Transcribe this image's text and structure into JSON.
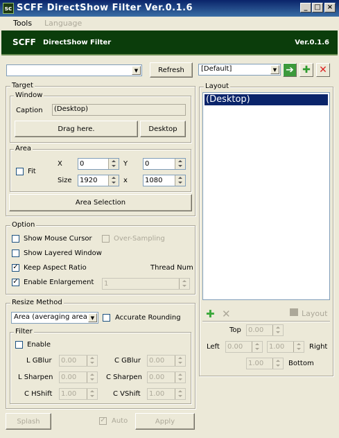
{
  "window": {
    "title": "SCFF DirectShow Filter Ver.0.1.6",
    "icon_text": "sc",
    "minimize": "_",
    "maximize": "□",
    "close": "×"
  },
  "menu": {
    "tools": "Tools",
    "language": "Language"
  },
  "banner": {
    "brand": "SCFF",
    "subtitle": "DirectShow Filter",
    "version": "Ver.0.1.6"
  },
  "top": {
    "process_combo": "",
    "refresh": "Refresh",
    "profile_combo": "[Default]"
  },
  "target": {
    "group": "Target",
    "window_group": "Window",
    "caption_label": "Caption",
    "caption_value": "(Desktop)",
    "drag_here": "Drag here.",
    "desktop": "Desktop",
    "area_group": "Area",
    "fit": "Fit",
    "x_label": "X",
    "y_label": "Y",
    "size_label": "Size",
    "x_sep": "x",
    "x_value": "0",
    "y_value": "0",
    "width": "1920",
    "height": "1080",
    "area_selection": "Area Selection"
  },
  "option": {
    "group": "Option",
    "show_mouse_cursor": "Show Mouse Cursor",
    "over_sampling": "Over-Sampling",
    "show_layered_window": "Show Layered Window",
    "keep_aspect_ratio": "Keep Aspect Ratio",
    "thread_num": "Thread Num",
    "enable_enlargement": "Enable Enlargement",
    "thread_value": "1"
  },
  "resize": {
    "group": "Resize Method",
    "method": "Area (averaging area)",
    "accurate_rounding": "Accurate Rounding",
    "filter_group": "Filter",
    "enable": "Enable",
    "l_gblur": "L GBlur",
    "c_gblur": "C GBlur",
    "l_sharpen": "L Sharpen",
    "c_sharpen": "C Sharpen",
    "c_hshift": "C HShift",
    "c_vshift": "C VShift",
    "l_gblur_v": "0.00",
    "c_gblur_v": "0.00",
    "l_sharpen_v": "0.00",
    "c_sharpen_v": "0.00",
    "c_hshift_v": "1.00",
    "c_vshift_v": "1.00"
  },
  "bottom": {
    "splash": "Splash",
    "auto": "Auto",
    "apply": "Apply"
  },
  "layout": {
    "group": "Layout",
    "items": [
      "(Desktop)"
    ],
    "layout_button": "Layout",
    "top": "Top",
    "left": "Left",
    "right": "Right",
    "bottom": "Bottom",
    "top_v": "0.00",
    "left_v": "0.00",
    "right_v": "1.00",
    "bottom_v": "1.00"
  }
}
